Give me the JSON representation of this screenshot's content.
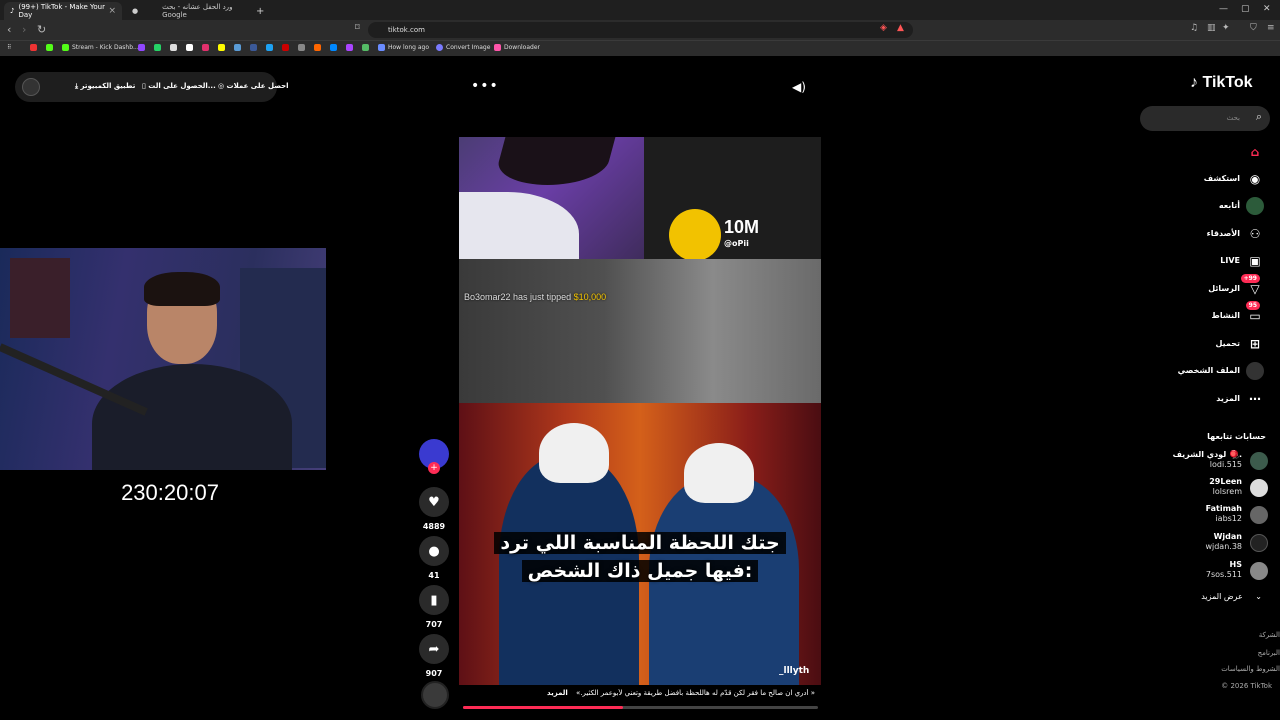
{
  "browser": {
    "tabs": [
      {
        "label": "(99+) TikTok - Make Your Day",
        "close": "×"
      },
      {
        "label": "ورد الحفل عشانه - بحث Google",
        "close": ""
      }
    ],
    "new_tab": "+",
    "window_controls": [
      "—",
      "▢",
      "✕"
    ],
    "url": "tiktok.com",
    "bookmarks": [
      "Stream - Kick Dashb...",
      "How long ago",
      "Convert Image",
      "Downloader"
    ]
  },
  "top_bar": {
    "get_coins": "احصل على عملات",
    "get_app": "الحصول على الت...",
    "pc_app": "تطبيق الكمبيوتر"
  },
  "stream": {
    "timer": "230:20:07"
  },
  "video": {
    "tip_user": "Bo3omar22",
    "tip_text": "has just tipped",
    "tip_amount": "$10,000",
    "badge_number": "10M",
    "handle": "@oPii",
    "caption_line1": "جتك اللحظة المناسبة اللي ترد",
    "caption_line2": "فيها جميل ذاك الشخص:",
    "watermark": "_lllyth",
    "description": "« أدري ان صالح ما فقر لكن قدّم له هاللحظة بأفضل طريقة وتعني لأبوعمر الكثير.»",
    "more": "المزيد",
    "progress": 0.45
  },
  "actions": {
    "plus": "+",
    "likes": "4889",
    "comments": "41",
    "saves": "707",
    "shares": "907"
  },
  "sidebar": {
    "logo": "TikTok",
    "search_placeholder": "بحث",
    "nav": [
      {
        "label": "",
        "icon": "home-icon"
      },
      {
        "label": "استكشف",
        "icon": "compass-icon"
      },
      {
        "label": "أتابعه",
        "icon": "following-icon"
      },
      {
        "label": "الأصدقاء",
        "icon": "friends-icon"
      },
      {
        "label": "LIVE",
        "icon": "live-icon"
      },
      {
        "label": "الرسائل",
        "icon": "messages-icon",
        "badge": "+99"
      },
      {
        "label": "النشاط",
        "icon": "activity-icon",
        "badge": "95"
      },
      {
        "label": "تحميل",
        "icon": "upload-icon"
      },
      {
        "label": "الملف الشخصي",
        "icon": "profile-icon"
      },
      {
        "label": "المزيد",
        "icon": "more-icon"
      }
    ],
    "following_header": "حسابات تتابعها",
    "accounts": [
      {
        "name": "لودي الشريف 🪀.",
        "handle": "lodi.515"
      },
      {
        "name": "29Leen",
        "handle": "lolsrem"
      },
      {
        "name": "Fatimah",
        "handle": "iabs12"
      },
      {
        "name": "Wjdan",
        "handle": "wjdan.38"
      },
      {
        "name": "HS",
        "handle": "7sos.511"
      }
    ],
    "see_more": "عرض المزيد",
    "footer": [
      "الشركة",
      "البرنامج",
      "الشروط والسياسات",
      "© 2026 TikTok"
    ]
  }
}
